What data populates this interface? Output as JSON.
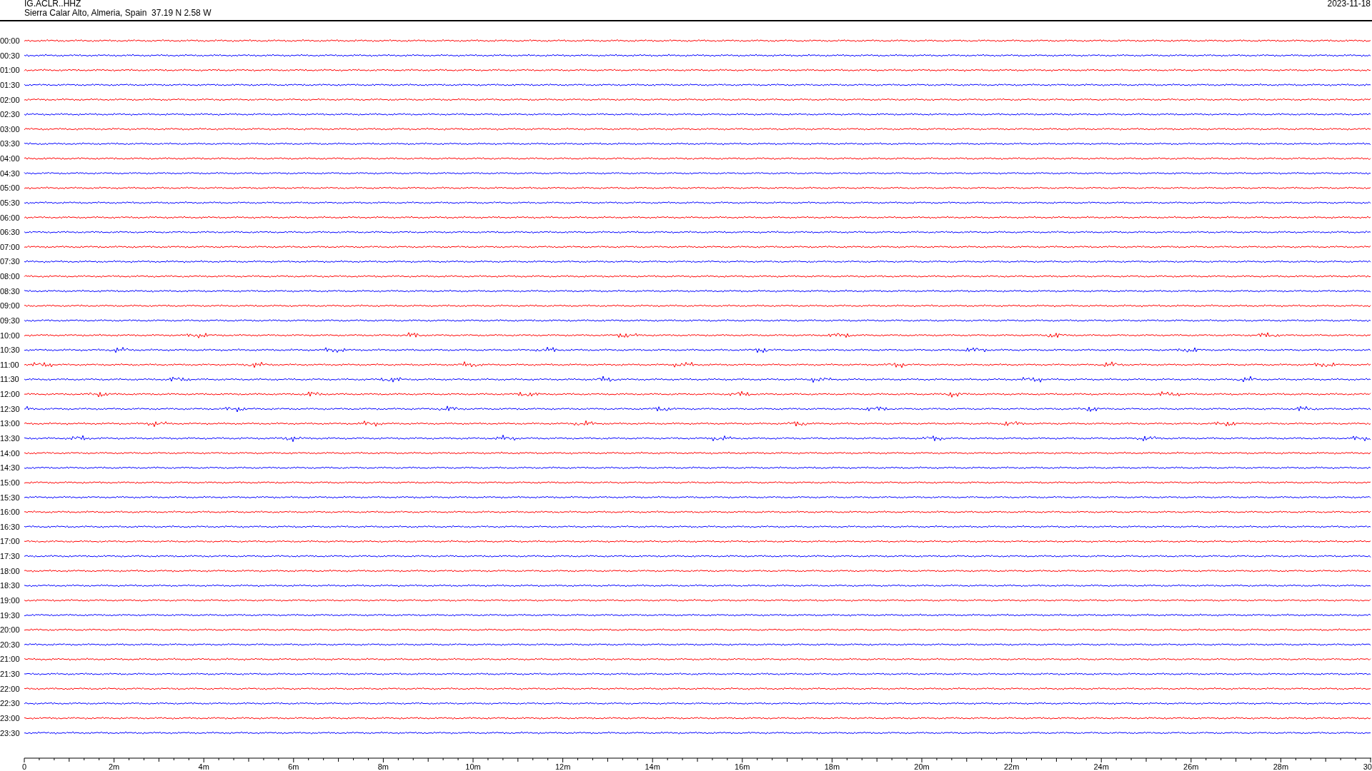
{
  "header": {
    "station_code": "IG.ACLR..HHZ",
    "station_location": "Sierra Calar Alto, Almeria, Spain  37.19 N 2.58 W",
    "date": "2023-11-18"
  },
  "rows": [
    {
      "time": "00:00",
      "color": "#ff0000"
    },
    {
      "time": "00:30",
      "color": "#0000ff"
    },
    {
      "time": "01:00",
      "color": "#ff0000"
    },
    {
      "time": "01:30",
      "color": "#0000ff"
    },
    {
      "time": "02:00",
      "color": "#ff0000"
    },
    {
      "time": "02:30",
      "color": "#0000ff"
    },
    {
      "time": "03:00",
      "color": "#ff0000"
    },
    {
      "time": "03:30",
      "color": "#0000ff"
    },
    {
      "time": "04:00",
      "color": "#ff0000"
    },
    {
      "time": "04:30",
      "color": "#0000ff"
    },
    {
      "time": "05:00",
      "color": "#ff0000"
    },
    {
      "time": "05:30",
      "color": "#0000ff"
    },
    {
      "time": "06:00",
      "color": "#ff0000"
    },
    {
      "time": "06:30",
      "color": "#0000ff"
    },
    {
      "time": "07:00",
      "color": "#ff0000"
    },
    {
      "time": "07:30",
      "color": "#0000ff"
    },
    {
      "time": "08:00",
      "color": "#ff0000"
    },
    {
      "time": "08:30",
      "color": "#0000ff"
    },
    {
      "time": "09:00",
      "color": "#ff0000"
    },
    {
      "time": "09:30",
      "color": "#0000ff"
    },
    {
      "time": "10:00",
      "color": "#ff0000"
    },
    {
      "time": "10:30",
      "color": "#0000ff"
    },
    {
      "time": "11:00",
      "color": "#ff0000"
    },
    {
      "time": "11:30",
      "color": "#0000ff"
    },
    {
      "time": "12:00",
      "color": "#ff0000"
    },
    {
      "time": "12:30",
      "color": "#0000ff"
    },
    {
      "time": "13:00",
      "color": "#ff0000"
    },
    {
      "time": "13:30",
      "color": "#0000ff"
    },
    {
      "time": "14:00",
      "color": "#ff0000"
    },
    {
      "time": "14:30",
      "color": "#0000ff"
    },
    {
      "time": "15:00",
      "color": "#ff0000"
    },
    {
      "time": "15:30",
      "color": "#0000ff"
    },
    {
      "time": "16:00",
      "color": "#ff0000"
    },
    {
      "time": "16:30",
      "color": "#0000ff"
    },
    {
      "time": "17:00",
      "color": "#ff0000"
    },
    {
      "time": "17:30",
      "color": "#0000ff"
    },
    {
      "time": "18:00",
      "color": "#ff0000"
    },
    {
      "time": "18:30",
      "color": "#0000ff"
    },
    {
      "time": "19:00",
      "color": "#ff0000"
    },
    {
      "time": "19:30",
      "color": "#0000ff"
    },
    {
      "time": "20:00",
      "color": "#ff0000"
    },
    {
      "time": "20:30",
      "color": "#0000ff"
    },
    {
      "time": "21:00",
      "color": "#ff0000"
    },
    {
      "time": "21:30",
      "color": "#0000ff"
    },
    {
      "time": "22:00",
      "color": "#ff0000"
    },
    {
      "time": "22:30",
      "color": "#0000ff"
    },
    {
      "time": "23:00",
      "color": "#ff0000"
    },
    {
      "time": "23:30",
      "color": "#0000ff"
    }
  ],
  "time_axis": {
    "labels": [
      "0",
      "2m",
      "4m",
      "6m",
      "8m",
      "10m",
      "12m",
      "14m",
      "16m",
      "18m",
      "20m",
      "22m",
      "24m",
      "26m",
      "28m",
      "30"
    ]
  }
}
